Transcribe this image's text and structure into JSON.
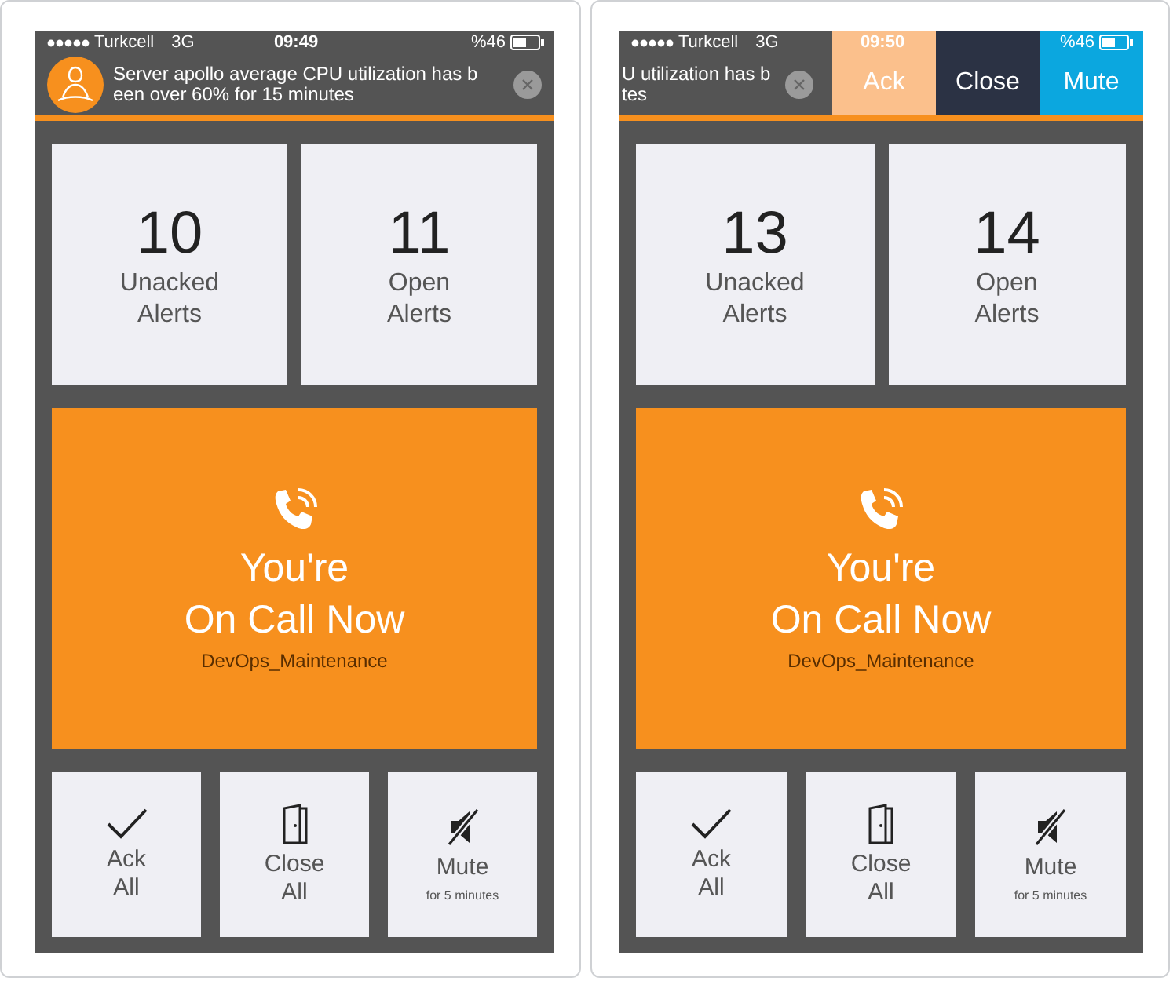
{
  "phones": [
    {
      "status": {
        "carrier": "Turkcell",
        "network": "3G",
        "time": "09:49",
        "battery": "%46"
      },
      "notification": {
        "kind": "banner",
        "lines": [
          "Server apollo average CPU utilization has b",
          "een over 60% for 15 minutes"
        ]
      },
      "stats": [
        {
          "value": "10",
          "label": "Unacked\nAlerts"
        },
        {
          "value": "11",
          "label": "Open\nAlerts"
        }
      ],
      "on_call": {
        "title": "You're\nOn Call Now",
        "team": "DevOps_Maintenance"
      },
      "actions": [
        {
          "kind": "ack",
          "label": "Ack\nAll"
        },
        {
          "kind": "close",
          "label": "Close\nAll"
        },
        {
          "kind": "mute",
          "label": "Mute",
          "note": "for 5 minutes"
        }
      ]
    },
    {
      "status": {
        "carrier": "Turkcell",
        "network": "3G",
        "time": "09:50",
        "battery": "%46"
      },
      "notification": {
        "kind": "swiped",
        "lines": [
          "U utilization has b",
          "tes"
        ],
        "buttons": [
          {
            "kind": "ack",
            "label": "Ack"
          },
          {
            "kind": "close",
            "label": "Close"
          },
          {
            "kind": "mute",
            "label": "Mute"
          }
        ]
      },
      "stats": [
        {
          "value": "13",
          "label": "Unacked\nAlerts"
        },
        {
          "value": "14",
          "label": "Open\nAlerts"
        }
      ],
      "on_call": {
        "title": "You're\nOn Call Now",
        "team": "DevOps_Maintenance"
      },
      "actions": [
        {
          "kind": "ack",
          "label": "Ack\nAll"
        },
        {
          "kind": "close",
          "label": "Close\nAll"
        },
        {
          "kind": "mute",
          "label": "Mute",
          "note": "for 5 minutes"
        }
      ]
    }
  ]
}
